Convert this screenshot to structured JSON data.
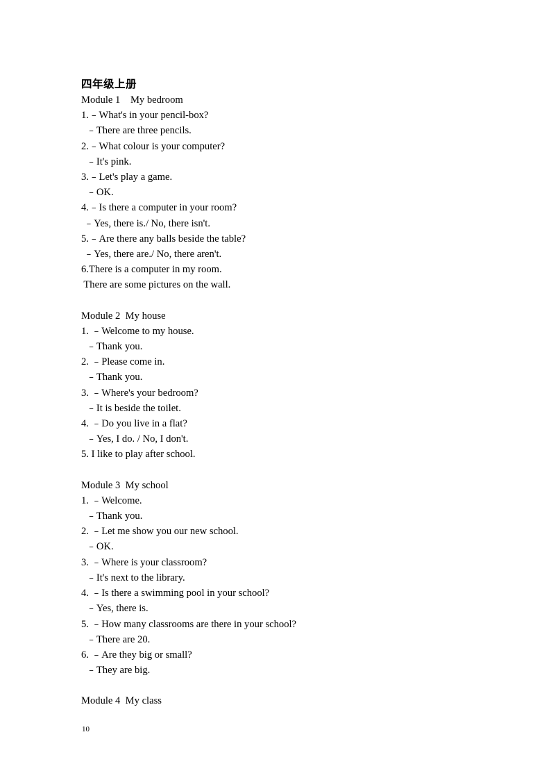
{
  "document": {
    "title": "四年级上册",
    "page_number": "10",
    "modules": [
      {
        "heading": "Module 1    My bedroom",
        "lines": [
          "1.﹣What's in your pencil-box?",
          "  ﹣There are three pencils.",
          "2.﹣What colour is your computer?",
          "  ﹣It's pink.",
          "3.﹣Let's play a game.",
          "  ﹣OK.",
          "4.﹣Is there a computer in your room?",
          " ﹣Yes, there is./ No, there isn't.",
          "5.﹣Are there any balls beside the table?",
          " ﹣Yes, there are./ No, there aren't.",
          "6.There is a computer in my room.",
          " There are some pictures on the wall."
        ]
      },
      {
        "heading": "Module 2  My house",
        "lines": [
          "1. ﹣Welcome to my house.",
          "  ﹣Thank you.",
          "2. ﹣Please come in.",
          "  ﹣Thank you.",
          "3. ﹣Where's your bedroom?",
          "  ﹣It is beside the toilet.",
          "4. ﹣Do you live in a flat?",
          "  ﹣Yes, I do. / No, I don't.",
          "5. I like to play after school."
        ]
      },
      {
        "heading": "Module 3  My school",
        "lines": [
          "1. ﹣Welcome.",
          "  ﹣Thank you.",
          "2. ﹣Let me show you our new school.",
          "  ﹣OK.",
          "3. ﹣Where is your classroom?",
          "  ﹣It's next to the library.",
          "4. ﹣Is there a swimming pool in your school?",
          "  ﹣Yes, there is.",
          "5. ﹣How many classrooms are there in your school?",
          "  ﹣There are 20.",
          "6. ﹣Are they big or small?",
          "  ﹣They are big."
        ]
      },
      {
        "heading": "Module 4  My class",
        "lines": []
      }
    ]
  }
}
